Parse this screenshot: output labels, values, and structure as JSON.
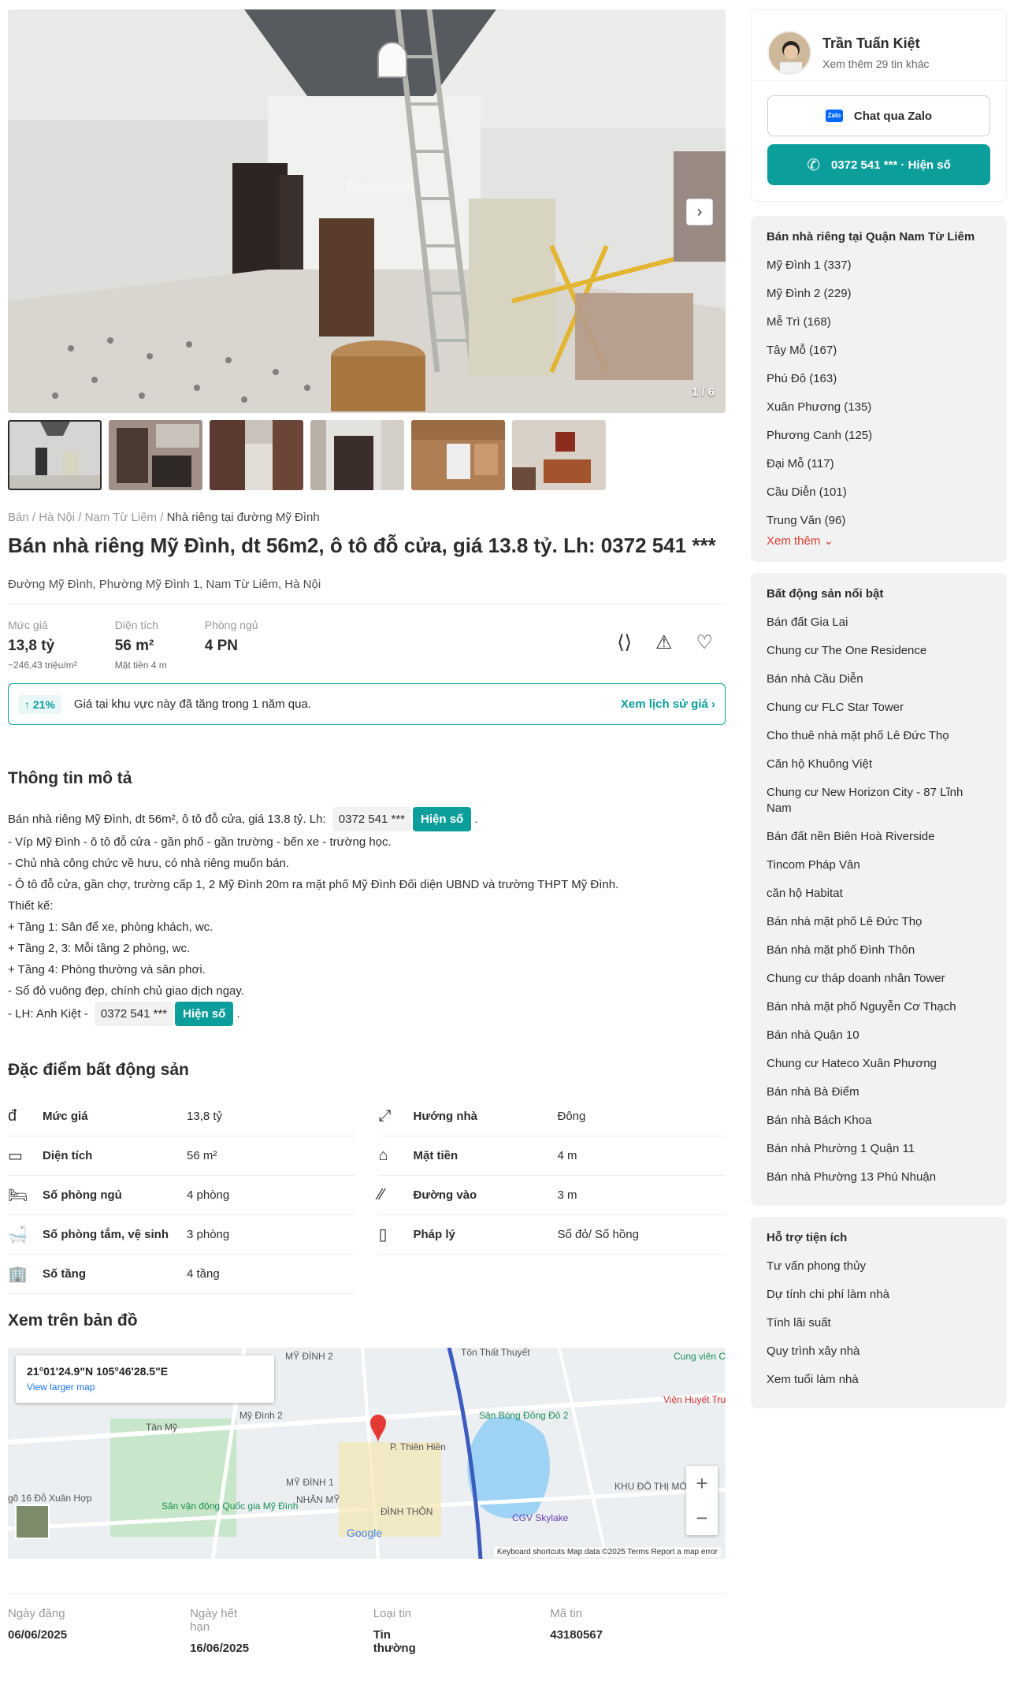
{
  "gallery": {
    "counter": "1 / 6",
    "next_icon": "chevron-right-icon",
    "watermark": "Batdongsan"
  },
  "breadcrumb": [
    "Bán",
    "Hà Nội",
    "Nam Từ Liêm",
    "Nhà riêng tại đường Mỹ Đình"
  ],
  "listing": {
    "title": "Bán nhà riêng Mỹ Đình, dt 56m2, ô tô đỗ cửa, giá 13.8 tỷ. Lh: 0372 541 ***",
    "address": "Đường Mỹ Đình, Phường Mỹ Đình 1, Nam Từ Liêm, Hà Nội"
  },
  "stats": {
    "price_label": "Mức giá",
    "price_value": "13,8 tỷ",
    "price_sub": "~246,43 triệu/m²",
    "area_label": "Diện tích",
    "area_value": "56 m²",
    "area_sub": "Mặt tiền 4 m",
    "rooms_label": "Phòng ngủ",
    "rooms_value": "4 PN"
  },
  "trend": {
    "badge": "↑ 21%",
    "text": "Giá tại khu vực này đã tăng trong 1 năm qua.",
    "link": "Xem lịch sử giá"
  },
  "description": {
    "heading": "Thông tin mô tả",
    "first_line": "Bán nhà riêng Mỹ Đình, dt 56m², ô tô đỗ cửa, giá 13.8 tỷ. Lh:",
    "phone": "0372 541 ***",
    "show": "Hiện số",
    "lines": [
      "- Víp Mỹ Đình - ô tô đỗ cửa - gần phố - gần trường - bến xe - trường học.",
      "- Chủ nhà công chức về hưu, có nhà riêng muốn bán.",
      "- Ô tô đỗ cửa, gần chợ, trường cấp 1, 2 Mỹ Đình 20m ra mặt phố Mỹ Đình Đối diện UBND và trường THPT Mỹ Đình.",
      "Thiết kế:",
      "+ Tầng 1: Sân để xe, phòng khách, wc.",
      "+ Tầng 2, 3: Mỗi tầng 2 phòng, wc.",
      "+ Tầng 4: Phòng thường và sân phơi.",
      "- Sổ đỏ vuông đẹp, chính chủ giao dịch ngay."
    ],
    "contact_prefix": "- LH: Anh Kiệt -"
  },
  "features": {
    "heading": "Đặc điểm bất động sản",
    "left": [
      {
        "icon": "price-icon",
        "glyph": "đ",
        "key": "Mức giá",
        "value": "13,8 tỷ"
      },
      {
        "icon": "area-icon",
        "glyph": "▭",
        "key": "Diện tích",
        "value": "56 m²"
      },
      {
        "icon": "bed-icon",
        "glyph": "🛏",
        "key": "Số phòng ngủ",
        "value": "4 phòng"
      },
      {
        "icon": "bath-icon",
        "glyph": "🛁",
        "key": "Số phòng tắm, vệ sinh",
        "value": "3 phòng"
      },
      {
        "icon": "floors-icon",
        "glyph": "🏢",
        "key": "Số tầng",
        "value": "4 tầng"
      }
    ],
    "right": [
      {
        "icon": "direction-icon",
        "glyph": "⤢",
        "key": "Hướng nhà",
        "value": "Đông"
      },
      {
        "icon": "frontage-icon",
        "glyph": "⌂",
        "key": "Mặt tiền",
        "value": "4 m"
      },
      {
        "icon": "road-icon",
        "glyph": "⁄⁄",
        "key": "Đường vào",
        "value": "3 m"
      },
      {
        "icon": "legal-icon",
        "glyph": "▯",
        "key": "Pháp lý",
        "value": "Sổ đỏ/ Sổ hồng"
      }
    ]
  },
  "map": {
    "heading": "Xem trên bản đồ",
    "coords": "21°01'24.9\"N 105°46'28.5\"E",
    "link": "View larger map",
    "labels": [
      "MỸ ĐÌNH 2",
      "Mỹ Đình 2",
      "Tôn Thất Thuyết",
      "Sân Bóng Đông Đô 2",
      "Viện Huyết Truyền máu",
      "Sân vận động Quốc gia Mỹ Đình",
      "MỸ ĐÌNH 1",
      "NHÂN MỸ",
      "ĐÌNH THÔN",
      "CGV Skylake",
      "KHU ĐÔ THỊ MỚI",
      "Tân Mỹ",
      "P. Thiên Hiền",
      "Cung viên Cầu Giấy",
      "gõ 16 Đỗ Xuân Hợp"
    ],
    "footer": "Keyboard shortcuts   Map data ©2025   Terms   Report a map error",
    "google": "Google"
  },
  "meta": [
    {
      "label": "Ngày đăng",
      "value": "06/06/2025"
    },
    {
      "label": "Ngày hết hạn",
      "value": "16/06/2025"
    },
    {
      "label": "Loại tin",
      "value": "Tin thường"
    },
    {
      "label": "Mã tin",
      "value": "43180567"
    }
  ],
  "agent": {
    "name": "Trần Tuấn Kiệt",
    "more": "Xem thêm 29 tin khác",
    "zalo": "Chat qua Zalo",
    "zalo_mark": "Zalo",
    "phone": "0372 541 *** · Hiện số"
  },
  "district_panel": {
    "title": "Bán nhà riêng tại Quận Nam Từ Liêm",
    "items": [
      "Mỹ Đình 1 (337)",
      "Mỹ Đình 2 (229)",
      "Mễ Trì (168)",
      "Tây Mỗ (167)",
      "Phú Đô (163)",
      "Xuân Phương (135)",
      "Phương Canh (125)",
      "Đại Mỗ (117)",
      "Cầu Diễn (101)",
      "Trung Văn (96)"
    ],
    "more": "Xem thêm ⌄"
  },
  "featured_panel": {
    "title": "Bất động sản nổi bật",
    "items": [
      "Bán đất Gia Lai",
      "Chung cư The One Residence",
      "Bán nhà Cầu Diễn",
      "Chung cư FLC Star Tower",
      "Cho thuê nhà mặt phố Lê Đức Thọ",
      "Căn hộ Khuông Việt",
      "Chung cư New Horizon City - 87 Lĩnh Nam",
      "Bán đất nền Biên Hoà Riverside",
      "Tincom Pháp Vân",
      "căn hộ Habitat",
      "Bán nhà mặt phố Lê Đức Thọ",
      "Bán nhà mặt phố Đình Thôn",
      "Chung cư tháp doanh nhân Tower",
      "Bán nhà mặt phố Nguyễn Cơ Thạch",
      "Bán nhà Quận 10",
      "Chung cư Hateco Xuân Phương",
      "Bán nhà Bà Điểm",
      "Bán nhà Bách Khoa",
      "Bán nhà Phường 1 Quận 11",
      "Bán nhà Phường 13 Phú Nhuận"
    ]
  },
  "tools_panel": {
    "title": "Hỗ trợ tiện ích",
    "items": [
      "Tư vấn phong thủy",
      "Dự tính chi phí làm nhà",
      "Tính lãi suất",
      "Quy trình xây nhà",
      "Xem tuổi làm nhà"
    ]
  },
  "colors": {
    "brand": "#0c9e9b",
    "more": "#e03c31"
  }
}
